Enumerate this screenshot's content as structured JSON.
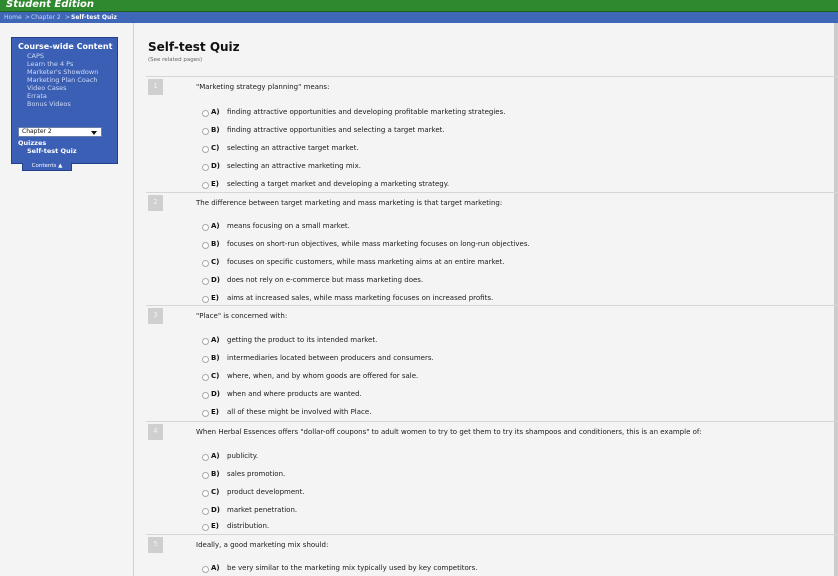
{
  "app": {
    "title": "Student Edition"
  },
  "breadcrumb": {
    "home": "Home",
    "sep1": ">",
    "chapter": "Chapter 2",
    "sep2": ">",
    "current": "Self-test Quiz"
  },
  "sidebar": {
    "heading": "Course-wide Content",
    "links": [
      "CAPS",
      "Learn the 4 Ps",
      "Marketer's Showdown",
      "Marketing Plan Coach",
      "Video Cases",
      "Errata",
      "Bonus Videos"
    ],
    "chapter_select": "Chapter 2",
    "quizzes_heading": "Quizzes",
    "quiz_link": "Self-test Quiz",
    "contents_tab": "Contents ▲"
  },
  "main": {
    "title": "Self-test Quiz",
    "related": "(See related pages)",
    "questions": [
      {
        "number": "1",
        "text": "\"Marketing strategy planning\" means:",
        "options": [
          {
            "letter": "A)",
            "text": "finding attractive opportunities and developing profitable marketing strategies."
          },
          {
            "letter": "B)",
            "text": "finding attractive opportunities and selecting a target market."
          },
          {
            "letter": "C)",
            "text": "selecting an attractive target market."
          },
          {
            "letter": "D)",
            "text": "selecting an attractive marketing mix."
          },
          {
            "letter": "E)",
            "text": "selecting a target market and developing a marketing strategy."
          }
        ]
      },
      {
        "number": "2",
        "text": "The difference between target marketing and mass marketing is that target marketing:",
        "options": [
          {
            "letter": "A)",
            "text": "means focusing on a small market."
          },
          {
            "letter": "B)",
            "text": "focuses on short-run objectives, while mass marketing focuses on long-run objectives."
          },
          {
            "letter": "C)",
            "text": "focuses on specific customers, while mass marketing aims at an entire market."
          },
          {
            "letter": "D)",
            "text": "does not rely on e-commerce but mass marketing does."
          },
          {
            "letter": "E)",
            "text": "aims at increased sales, while mass marketing focuses on increased profits."
          }
        ]
      },
      {
        "number": "3",
        "text": "\"Place\" is concerned with:",
        "options": [
          {
            "letter": "A)",
            "text": "getting the product to its intended market."
          },
          {
            "letter": "B)",
            "text": "intermediaries located between producers and consumers."
          },
          {
            "letter": "C)",
            "text": "where, when, and by whom goods are offered for sale."
          },
          {
            "letter": "D)",
            "text": "when and where products are wanted."
          },
          {
            "letter": "E)",
            "text": "all of these might be involved with Place."
          }
        ]
      },
      {
        "number": "4",
        "text": "When Herbal Essences offers \"dollar-off coupons\" to adult women to try to get them to try its shampoos and conditioners, this is an example of:",
        "options": [
          {
            "letter": "A)",
            "text": "publicity."
          },
          {
            "letter": "B)",
            "text": "sales promotion."
          },
          {
            "letter": "C)",
            "text": "product development."
          },
          {
            "letter": "D)",
            "text": "market penetration."
          },
          {
            "letter": "E)",
            "text": "distribution."
          }
        ]
      },
      {
        "number": "5",
        "text": "Ideally, a good marketing mix should:",
        "options": [
          {
            "letter": "A)",
            "text": "be very similar to the marketing mix typically used by key competitors."
          }
        ]
      }
    ]
  }
}
